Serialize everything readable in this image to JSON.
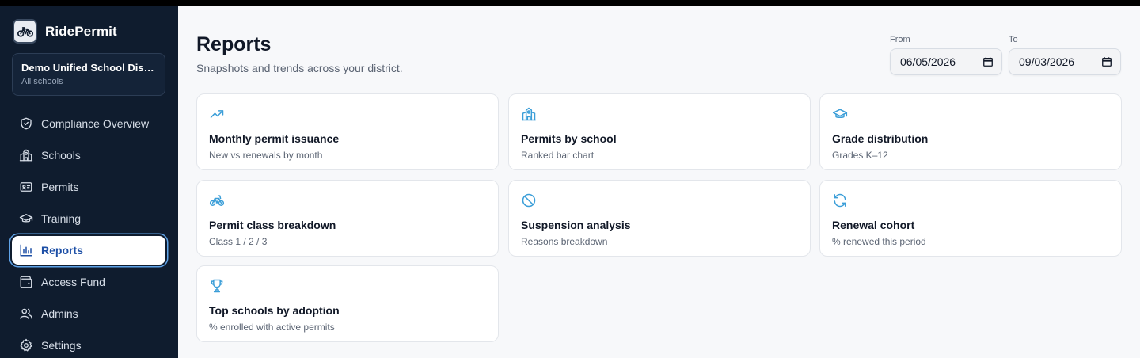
{
  "app": {
    "name": "RidePermit"
  },
  "org": {
    "name": "Demo Unified School District",
    "scope": "All schools"
  },
  "nav": [
    {
      "label": "Compliance Overview",
      "icon": "shield-icon"
    },
    {
      "label": "Schools",
      "icon": "school-icon"
    },
    {
      "label": "Permits",
      "icon": "id-card-icon"
    },
    {
      "label": "Training",
      "icon": "graduation-cap-icon"
    },
    {
      "label": "Reports",
      "icon": "bar-chart-icon",
      "active": true
    },
    {
      "label": "Access Fund",
      "icon": "wallet-icon"
    },
    {
      "label": "Admins",
      "icon": "users-icon"
    },
    {
      "label": "Settings",
      "icon": "gear-icon"
    }
  ],
  "page": {
    "title": "Reports",
    "subtitle": "Snapshots and trends across your district."
  },
  "filters": {
    "from_label": "From",
    "from_value": "06/05/2026",
    "to_label": "To",
    "to_value": "09/03/2026"
  },
  "cards": [
    {
      "title": "Monthly permit issuance",
      "subtitle": "New vs renewals by month",
      "icon": "trending-up-icon"
    },
    {
      "title": "Permits by school",
      "subtitle": "Ranked bar chart",
      "icon": "school-icon"
    },
    {
      "title": "Grade distribution",
      "subtitle": "Grades K–12",
      "icon": "graduation-cap-icon"
    },
    {
      "title": "Permit class breakdown",
      "subtitle": "Class 1 / 2 / 3",
      "icon": "bicycle-icon"
    },
    {
      "title": "Suspension analysis",
      "subtitle": "Reasons breakdown",
      "icon": "ban-icon"
    },
    {
      "title": "Renewal cohort",
      "subtitle": "% renewed this period",
      "icon": "refresh-icon"
    },
    {
      "title": "Top schools by adoption",
      "subtitle": "% enrolled with active permits",
      "icon": "trophy-icon"
    }
  ],
  "colors": {
    "accent": "#3b9ed8",
    "sidebar_bg": "#0f1c2e",
    "active_text": "#1d4fa6"
  }
}
